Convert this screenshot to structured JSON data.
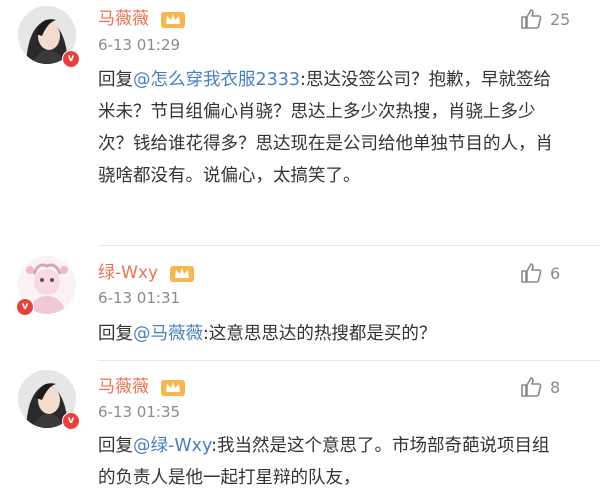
{
  "comments": [
    {
      "user": "马薇薇",
      "time": "6-13 01:29",
      "likes": "25",
      "reply_prefix": "回复",
      "mention": "@怎么穿我衣服2333",
      "text": ":思达没签公司？抱歉，早就签给米未？节目组偏心肖骁？思达上多少次热搜，肖骁上多少次？钱给谁花得多？思达现在是公司给他单独节目的人，肖骁啥都没有。说偏心，太搞笑了。"
    },
    {
      "user": "绿-Wxy",
      "time": "6-13 01:31",
      "likes": "6",
      "reply_prefix": "回复",
      "mention": "@马薇薇",
      "text": ":这意思思达的热搜都是买的？"
    },
    {
      "user": "马薇薇",
      "time": "6-13 01:35",
      "likes": "8",
      "reply_prefix": "回复",
      "mention": "@绿-Wxy",
      "text": ":我当然是这个意思了。市场部奇葩说项目组的负责人是他一起打星辩的队友，"
    }
  ],
  "icons": {
    "like": "thumbs-up-icon",
    "vip_badge": "crown-badge-icon",
    "verified": "verified-v-icon"
  },
  "colors": {
    "username": "#eb7350",
    "mention": "#4a7fbf",
    "meta": "#8a8a8a",
    "text": "#333333"
  }
}
